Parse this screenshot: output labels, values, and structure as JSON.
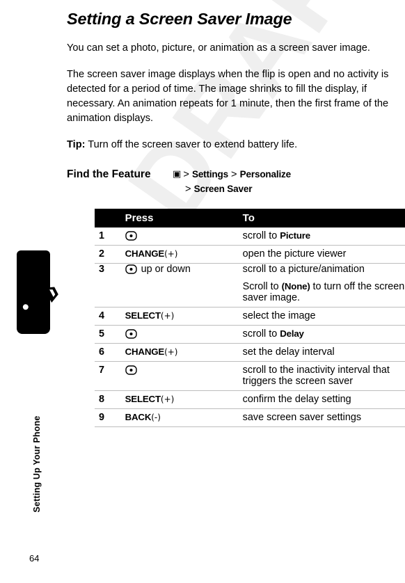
{
  "page": {
    "number": "64",
    "side_label": "Setting Up Your Phone",
    "watermark": "DRAFT"
  },
  "title": "Setting a Screen Saver Image",
  "paragraphs": [
    "You can set a photo, picture, or animation as a screen saver image.",
    "The screen saver image displays when the flip is open and no activity is detected for a period of time. The image shrinks to fill the display, if necessary. An animation repeats for 1 minute, then the first frame of the animation displays."
  ],
  "tip": {
    "lead": "Tip:",
    "text": " Turn off the screen saver to extend battery life."
  },
  "find_feature": {
    "label": "Find the Feature",
    "menu_icon": "menu-glyph-icon",
    "path_line1_sep1": ">",
    "path_item1": "Settings",
    "path_sep2": ">",
    "path_item2": "Personalize",
    "path_line2_sep": ">",
    "path_item3": "Screen Saver"
  },
  "table": {
    "headers": {
      "num": "",
      "press": "Press",
      "to": "To"
    },
    "rows": [
      {
        "num": "1",
        "press_icon": "nav-key-icon",
        "press_text": "",
        "press_suffix": "",
        "to_prefix": "scroll to ",
        "to_bold": "Picture",
        "to_suffix": ""
      },
      {
        "num": "2",
        "press_cmd": "CHANGE",
        "press_softkey": "(+)",
        "to_prefix": "open the picture viewer",
        "to_bold": "",
        "to_suffix": ""
      },
      {
        "num": "3",
        "press_icon": "nav-key-icon",
        "press_text": "up or down",
        "to_prefix": "scroll to a picture/animation",
        "to_bold": "",
        "to_suffix": ""
      },
      {
        "num": "",
        "press_text": "",
        "to_prefix": "Scroll to ",
        "to_bold": "(None)",
        "to_suffix": " to turn off the screen saver image."
      },
      {
        "num": "4",
        "press_cmd": "SELECT",
        "press_softkey": "(+)",
        "to_prefix": "select the image",
        "to_bold": "",
        "to_suffix": ""
      },
      {
        "num": "5",
        "press_icon": "nav-key-icon",
        "press_text": "",
        "to_prefix": "scroll to ",
        "to_bold": "Delay",
        "to_suffix": ""
      },
      {
        "num": "6",
        "press_cmd": "CHANGE",
        "press_softkey": "(+)",
        "to_prefix": "set the delay interval",
        "to_bold": "",
        "to_suffix": ""
      },
      {
        "num": "7",
        "press_icon": "nav-key-icon",
        "press_text": "",
        "to_prefix": "scroll to the inactivity interval that triggers the screen saver",
        "to_bold": "",
        "to_suffix": ""
      },
      {
        "num": "8",
        "press_cmd": "SELECT",
        "press_softkey": "(+)",
        "to_prefix": "confirm the delay setting",
        "to_bold": "",
        "to_suffix": ""
      },
      {
        "num": "9",
        "press_cmd": "BACK",
        "press_softkey": "(-)",
        "to_prefix": "save screen saver settings",
        "to_bold": "",
        "to_suffix": ""
      }
    ]
  }
}
